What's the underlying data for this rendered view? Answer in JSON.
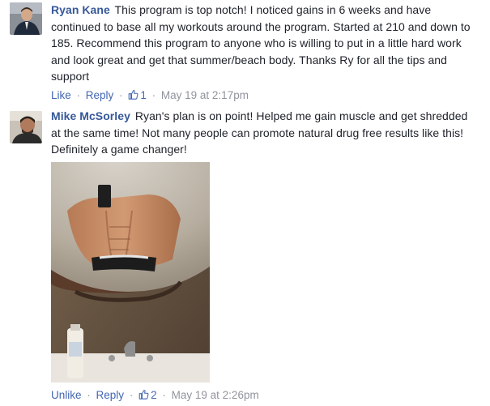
{
  "comments": [
    {
      "author": "Ryan Kane",
      "text": "This program is top notch! I noticed gains in 6 weeks and have continued to base all my workouts around the program. Started at 210 and down to 185. Recommend this program to anyone who is willing to put in a little hard work and look great and get that summer/beach body. Thanks Ry for all the tips and support",
      "actions": {
        "like": "Like",
        "reply": "Reply",
        "separator": "·",
        "likes": "1",
        "timestamp": "May 19 at 2:17pm"
      }
    },
    {
      "author": "Mike McSorley",
      "text": "Ryan's plan is on point! Helped me gain muscle and get shredded at the same time! Not many people can promote natural drug free results like this! Definitely a game changer!",
      "actions": {
        "like": "Unlike",
        "reply": "Reply",
        "separator": "·",
        "likes": "2",
        "timestamp": "May 19 at 2:26pm"
      }
    }
  ],
  "colors": {
    "link": "#365899",
    "action": "#4267b2",
    "meta": "#90949c"
  },
  "icons": [
    "thumbs-up-icon"
  ]
}
